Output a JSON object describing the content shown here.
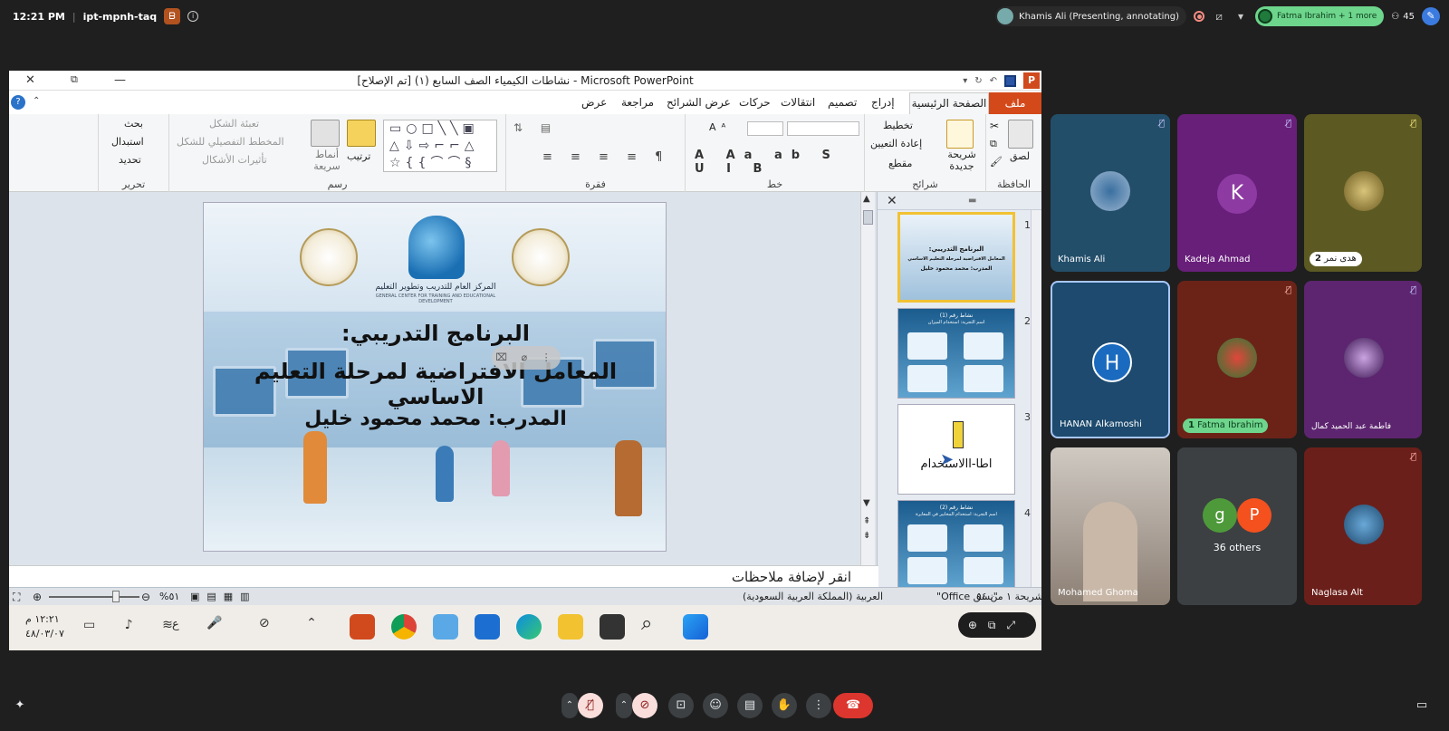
{
  "meet": {
    "time": "12:21 PM",
    "separator": "|",
    "meeting_code": "ipt-mpnh-taq",
    "host_badge": "ᗷ",
    "presenter_chip": "Khamis Ali (Presenting, annotating)",
    "speaker_chip": "Fatma Ibrahim + 1 more",
    "participant_count": "45"
  },
  "ppt": {
    "window_title": "نشاطات الكيمياء الصف السابع (١) [تم الإصلاح] - Microsoft PowerPoint",
    "tabs": {
      "file": "ملف",
      "home": "الصفحة الرئيسية",
      "insert": "إدراج",
      "design": "تصميم",
      "transitions": "انتقالات",
      "animations": "حركات",
      "slideshow": "عرض الشرائح",
      "review": "مراجعة",
      "view": "عرض"
    },
    "ribbon": {
      "clipboard": "الحافظة",
      "paste": "لصق",
      "slides": "شرائح",
      "new_slide": "شريحة جديدة",
      "layout": "تخطيط",
      "reset": "إعادة التعيين",
      "section": "مقطع",
      "font": "خط",
      "paragraph": "فقرة",
      "drawing": "رسم",
      "arrange": "ترتيب",
      "quick_styles": "أنماط سريعة",
      "shape_fill": "تعبئة الشكل",
      "shape_outline": "المخطط التفصيلي للشكل",
      "shape_effects": "تأثيرات الأشكال",
      "editing": "تحرير",
      "find": "بحث",
      "replace": "استبدال",
      "select": "تحديد"
    },
    "slide": {
      "center_name": "المركز العام للتدريب وتطوير التعليم",
      "center_sub": "GENERAL CENTER FOR TRAINING AND EDUCATIONAL DEVELOPMENT",
      "line1": "البرنامج التدريبي:",
      "line2": "المعامل الافتراضية لمرحلة التعليم الاساسي",
      "line3": "المدرب: محمد محمود خليل"
    },
    "thumbnails": {
      "n1": "1",
      "n2": "2",
      "n3": "3",
      "n4": "4",
      "t1_line1": "البرنامج التدريبي:",
      "t1_line2": "المعامل الافتراضية لمرحلة التعليم الاساسي",
      "t1_line3": "المدرب: محمد محمود خليل",
      "t2_title": "نشاط رقم (1)",
      "t2_sub": "اسم التجربة: استخدام الميزان",
      "t3_text": "اطا-االاستخدام",
      "t4_title": "نشاط رقم (2)",
      "t4_sub": "اسم التجربة: استخدام المخابير في المعايرة"
    },
    "notes_placeholder": "انقر لإضافة ملاحظات",
    "status": {
      "slide_of": "شريحة ١ من ٥٤",
      "theme": "\"نسق Office\"",
      "language": "العربية (المملكة العربية السعودية)",
      "zoom": "%٥١"
    }
  },
  "taskbar": {
    "clock_time": "١٢:٢١ م",
    "clock_date": "٤٨/٠٣/٠٧",
    "lang": "ع"
  },
  "tiles": {
    "t1": "Khamis Ali",
    "t2": "Kadeja Ahmad",
    "t2_letter": "K",
    "t3": "هدى نمر",
    "t3_count": "2",
    "t4": "HANAN Alkamoshi",
    "t4_letter": "H",
    "t5": "Fatma Ibrahim",
    "t5_count": "1",
    "t6": "فاطمة عبد الحميد كمال",
    "t7": "Mohamed Ghoma",
    "t8_g": "g",
    "t8_p": "P",
    "t8_others": "36 others",
    "t9": "Naglasa Alt"
  },
  "colors": {
    "ppt_orange": "#d3491a",
    "meet_bg": "#1f1f1f",
    "speaker_green": "#6dd58c",
    "end_call_red": "#dc362e"
  }
}
